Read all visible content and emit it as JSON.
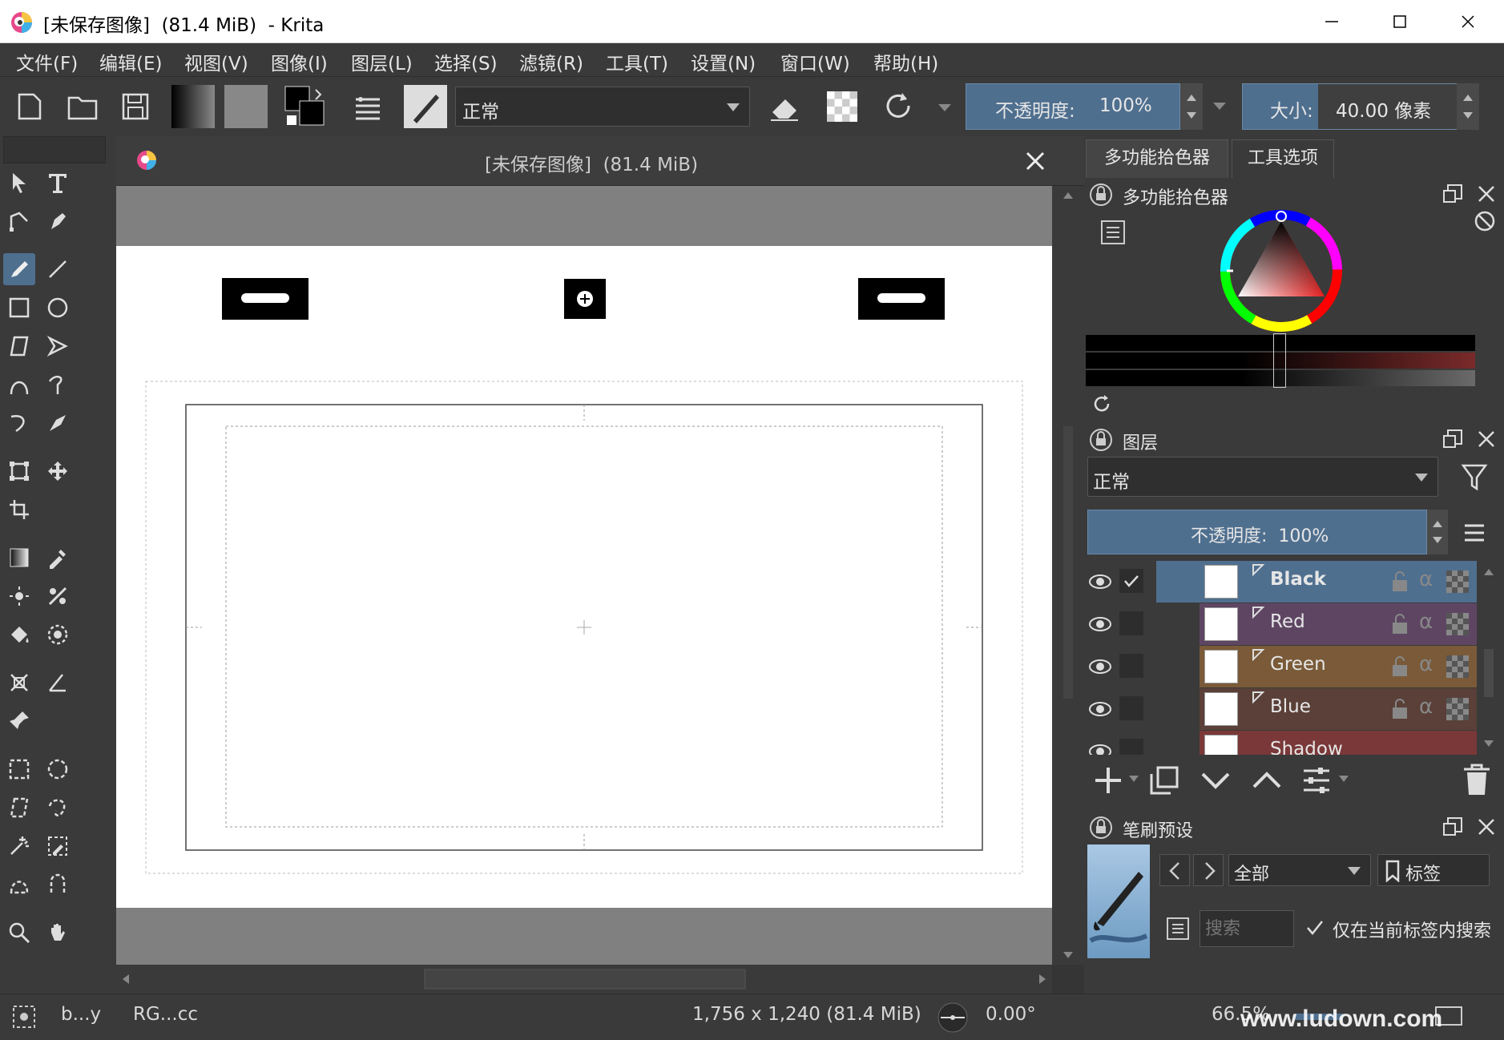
{
  "window": {
    "title": "[未保存图像]  (81.4 MiB)  - Krita"
  },
  "menubar": [
    "文件(F)",
    "编辑(E)",
    "视图(V)",
    "图像(I)",
    "图层(L)",
    "选择(S)",
    "滤镜(R)",
    "工具(T)",
    "设置(N)",
    "窗口(W)",
    "帮助(H)"
  ],
  "toolbar": {
    "blend_mode": "正常",
    "opacity_label": "不透明度:",
    "opacity_value": "100%",
    "size_label": "大小:",
    "size_value": "40.00 像素"
  },
  "document": {
    "tab_title": "[未保存图像]  (81.4 MiB)"
  },
  "right_panel": {
    "tabs": [
      "多功能拾色器",
      "工具选项"
    ],
    "color_selector_title": "多功能拾色器",
    "layers": {
      "title": "图层",
      "blend_mode": "正常",
      "opacity": "不透明度:  100%",
      "items": [
        {
          "name": "Black",
          "color": "#4f6f8f",
          "selected": true
        },
        {
          "name": "Red",
          "color": "#5e4663"
        },
        {
          "name": "Green",
          "color": "#7a5a38"
        },
        {
          "name": "Blue",
          "color": "#5a4038"
        },
        {
          "name": "Shadow",
          "color": "#7a3838"
        }
      ]
    },
    "brush_presets": {
      "title": "笔刷预设",
      "filter": "全部",
      "tag_label": "标签",
      "search_placeholder": "搜索",
      "search_in_tag_label": "仅在当前标签内搜索"
    }
  },
  "statusbar": {
    "brush": "b...y",
    "color_profile": "RG...cc",
    "image_size": "1,756 x 1,240 (81.4 MiB)",
    "rotation": "0.00°",
    "zoom": "66.5%"
  },
  "watermark": "www.ludown.com"
}
